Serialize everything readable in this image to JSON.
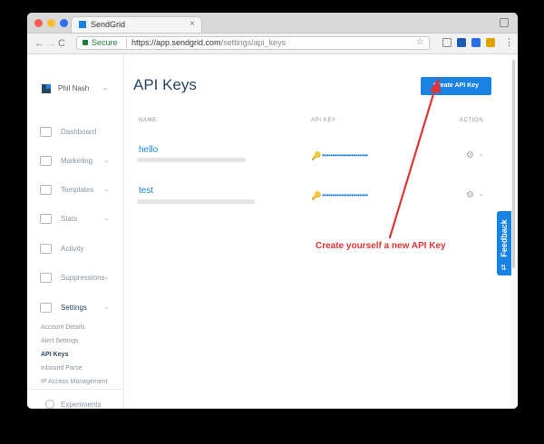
{
  "browser": {
    "tab_title": "SendGrid",
    "tab_close": "×",
    "secure_label": "Secure",
    "url_host": "https://app.sendgrid.com",
    "url_path": "/settings/api_keys",
    "nav_back": "←",
    "nav_forward": "→",
    "nav_reload": "C",
    "star": "☆",
    "menu": "⋮"
  },
  "sidebar": {
    "user_name": "Phil Nash",
    "user_chevron": "⌄",
    "items": [
      {
        "label": "Dashboard",
        "icon": "dashboard-icon",
        "chevron": ""
      },
      {
        "label": "Marketing",
        "icon": "marketing-icon",
        "chevron": "⌄"
      },
      {
        "label": "Templates",
        "icon": "templates-icon",
        "chevron": "⌄"
      },
      {
        "label": "Stats",
        "icon": "stats-icon",
        "chevron": "⌄"
      },
      {
        "label": "Activity",
        "icon": "activity-icon",
        "chevron": ""
      },
      {
        "label": "Suppressions",
        "icon": "suppressions-icon",
        "chevron": "⌄"
      },
      {
        "label": "Settings",
        "icon": "settings-icon",
        "chevron": "⌄"
      }
    ],
    "sub_items": [
      {
        "label": "Account Details"
      },
      {
        "label": "Alert Settings"
      },
      {
        "label": "API Keys"
      },
      {
        "label": "Inbound Parse"
      },
      {
        "label": "IP Access Management"
      }
    ],
    "bottom_item": {
      "label": "Experiments",
      "icon": "experiments-icon"
    }
  },
  "main": {
    "title": "API Keys",
    "create_button": "Create API Key",
    "columns": {
      "name": "NAME",
      "key": "API KEY",
      "action": "ACTION"
    },
    "rows": [
      {
        "name": "hello",
        "key_masked": "••••••••••••••••••••••",
        "gear": "⚙",
        "chevron": "⌄"
      },
      {
        "name": "test",
        "key_masked": "••••••••••••••••••••••",
        "gear": "⚙",
        "chevron": "⌄"
      }
    ]
  },
  "feedback": {
    "label": "Feedback",
    "icon": "⇅"
  },
  "annotation": {
    "text": "Create yourself a new API Key",
    "color": "#e03535"
  },
  "colors": {
    "accent": "#1a82e2",
    "navy": "#294661"
  }
}
